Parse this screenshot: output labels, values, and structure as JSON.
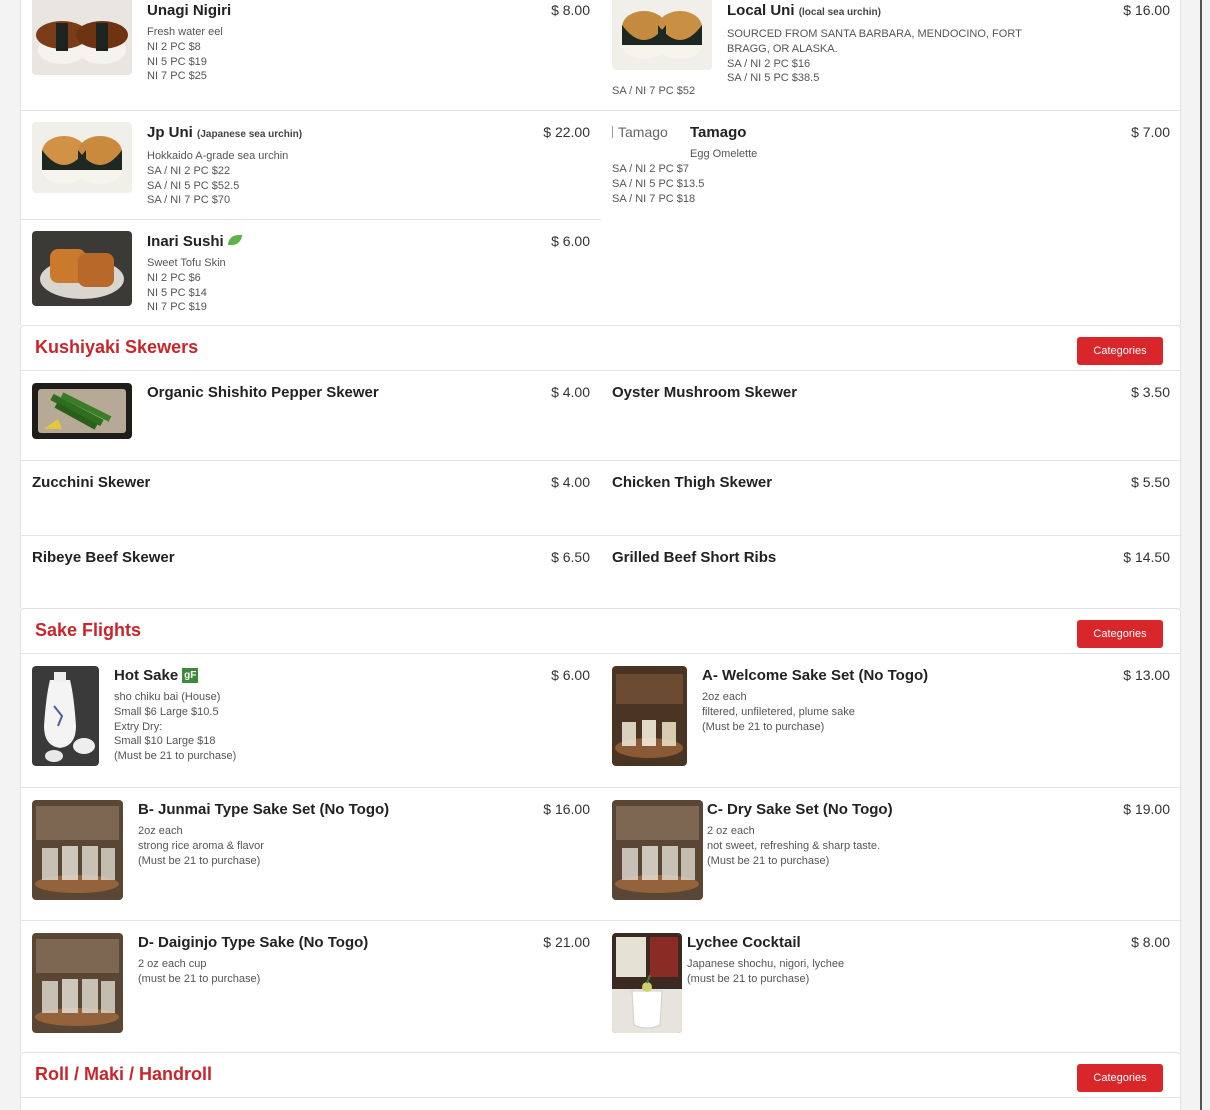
{
  "sushi": {
    "unagi": {
      "name": "Unagi Nigiri",
      "price": "$ 8.00",
      "lines": [
        "Fresh water eel",
        "NI 2 PC $8",
        "NI 5 PC $19",
        "NI 7 PC $25"
      ]
    },
    "local_uni": {
      "name": "Local Uni",
      "sub": "(local sea urchin)",
      "price": "$ 16.00",
      "lines": [
        "SOURCED FROM SANTA BARBARA, MENDOCINO, FORT",
        "BRAGG, OR ALASKA.",
        "SA / NI 2 PC $16",
        "SA / NI 5 PC $38.5"
      ],
      "extra": "SA / NI 7 PC $52"
    },
    "jp_uni": {
      "name": "Jp Uni",
      "sub": "(Japanese sea urchin)",
      "price": "$ 22.00",
      "lines": [
        "Hokkaido A-grade sea urchin",
        "SA / NI 2 PC $22",
        "SA / NI 5 PC $52.5",
        "SA / NI 7 PC $70"
      ]
    },
    "tamago": {
      "name": "Tamago",
      "alt": "Tamago",
      "price": "$ 7.00",
      "tagline": "Egg Omelette",
      "lines": [
        "SA / NI 2 PC $7",
        "SA / NI 5 PC $13.5",
        "SA / NI 7 PC $18"
      ]
    },
    "inari": {
      "name": "Inari Sushi",
      "price": "$ 6.00",
      "lines": [
        "Sweet Tofu Skin",
        "NI 2 PC $6",
        "NI 5 PC $14",
        "NI 7 PC $19"
      ]
    }
  },
  "kushiyaki": {
    "title": "Kushiyaki Skewers",
    "categories_label": "Categories",
    "items": [
      {
        "name": "Organic Shishito Pepper Skewer",
        "price": "$ 4.00"
      },
      {
        "name": "Oyster Mushroom Skewer",
        "price": "$ 3.50"
      },
      {
        "name": "Zucchini Skewer",
        "price": "$ 4.00"
      },
      {
        "name": "Chicken Thigh Skewer",
        "price": "$ 5.50"
      },
      {
        "name": "Ribeye Beef Skewer",
        "price": "$ 6.50"
      },
      {
        "name": "Grilled Beef Short Ribs",
        "price": "$ 14.50"
      }
    ]
  },
  "sake": {
    "title": "Sake Flights",
    "categories_label": "Categories",
    "hot_sake": {
      "name": "Hot Sake",
      "badge": "gF",
      "price": "$ 6.00",
      "lines": [
        "sho chiku bai (House)",
        "Small $6 Large $10.5",
        "Extry Dry:",
        "Small $10 Large $18",
        "(Must be 21 to purchase)"
      ]
    },
    "a_set": {
      "name": "A- Welcome Sake Set (No Togo)",
      "price": "$ 13.00",
      "lines": [
        "2oz each",
        "filtered, unfiletered, plume sake",
        "(Must be 21 to purchase)"
      ]
    },
    "b_set": {
      "name": "B- Junmai Type Sake Set (No Togo)",
      "price": "$ 16.00",
      "lines": [
        "2oz each",
        "strong rice aroma & flavor",
        "(Must be 21 to purchase)"
      ]
    },
    "c_set": {
      "name": "C- Dry Sake Set (No Togo)",
      "price": "$ 19.00",
      "lines": [
        "2 oz each",
        "not sweet, refreshing & sharp taste.",
        "(Must be 21 to purchase)"
      ]
    },
    "d_set": {
      "name": "D- Daiginjo Type Sake (No Togo)",
      "price": "$ 21.00",
      "lines": [
        "2 oz each cup",
        "(must be 21 to purchase)"
      ]
    },
    "lychee": {
      "name": "Lychee Cocktail",
      "price": "$ 8.00",
      "lines": [
        "Japanese shochu, nigori, lychee",
        "(must be 21 to purchase)"
      ]
    }
  },
  "roll": {
    "title": "Roll / Maki / Handroll",
    "categories_label": "Categories"
  },
  "colors": {
    "accent": "#c8262a",
    "button": "#d9262a"
  }
}
